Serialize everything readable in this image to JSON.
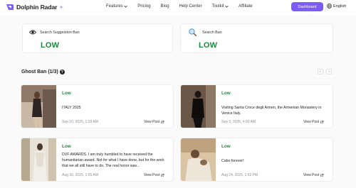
{
  "brand": {
    "name": "Dolphin Radar",
    "accent": "#7c5cf5"
  },
  "nav": {
    "items": [
      {
        "label": "Features",
        "dropdown": true
      },
      {
        "label": "Pricing",
        "dropdown": false
      },
      {
        "label": "Blog",
        "dropdown": false
      },
      {
        "label": "Help Center",
        "dropdown": false
      },
      {
        "label": "Toolkit",
        "dropdown": true
      },
      {
        "label": "Affiliate",
        "dropdown": false
      }
    ],
    "dashboard_label": "Dashboard",
    "language_label": "English"
  },
  "summary": {
    "suggestion": {
      "label": "Search Suggestion Ban",
      "value": "LOW",
      "icon": "eye-icon"
    },
    "search": {
      "label": "Search Ban",
      "value": "LOW",
      "icon": "magnifier-icon"
    }
  },
  "ghost": {
    "title": "Ghost Ban (1/3)",
    "help": "?"
  },
  "posts": [
    {
      "level": "Low",
      "caption": "ITALY 2025",
      "date": "Sep 10, 2025, 1:03 AM",
      "view_label": "View Post"
    },
    {
      "level": "Low",
      "caption": "Visiting Santa Croce degli Armen, the Armenian Monastery in Venice Italy.",
      "date": "Sep 3, 2025, 4:00 AM",
      "view_label": "View Post"
    },
    {
      "level": "Low",
      "caption": "DVF AWARDS. I am truly humbled to have received the humanitarian award. Not for what I have done, but for the work that we all still have to do. The real honor was...",
      "date": "Aug 30, 2025, 1:55 AM",
      "view_label": "View Post"
    },
    {
      "level": "Low",
      "caption": "Cabo forever!",
      "date": "Aug 24, 2025, 1:52 PM",
      "view_label": "View Post"
    }
  ],
  "colors": {
    "low": "#1c8a3c"
  }
}
